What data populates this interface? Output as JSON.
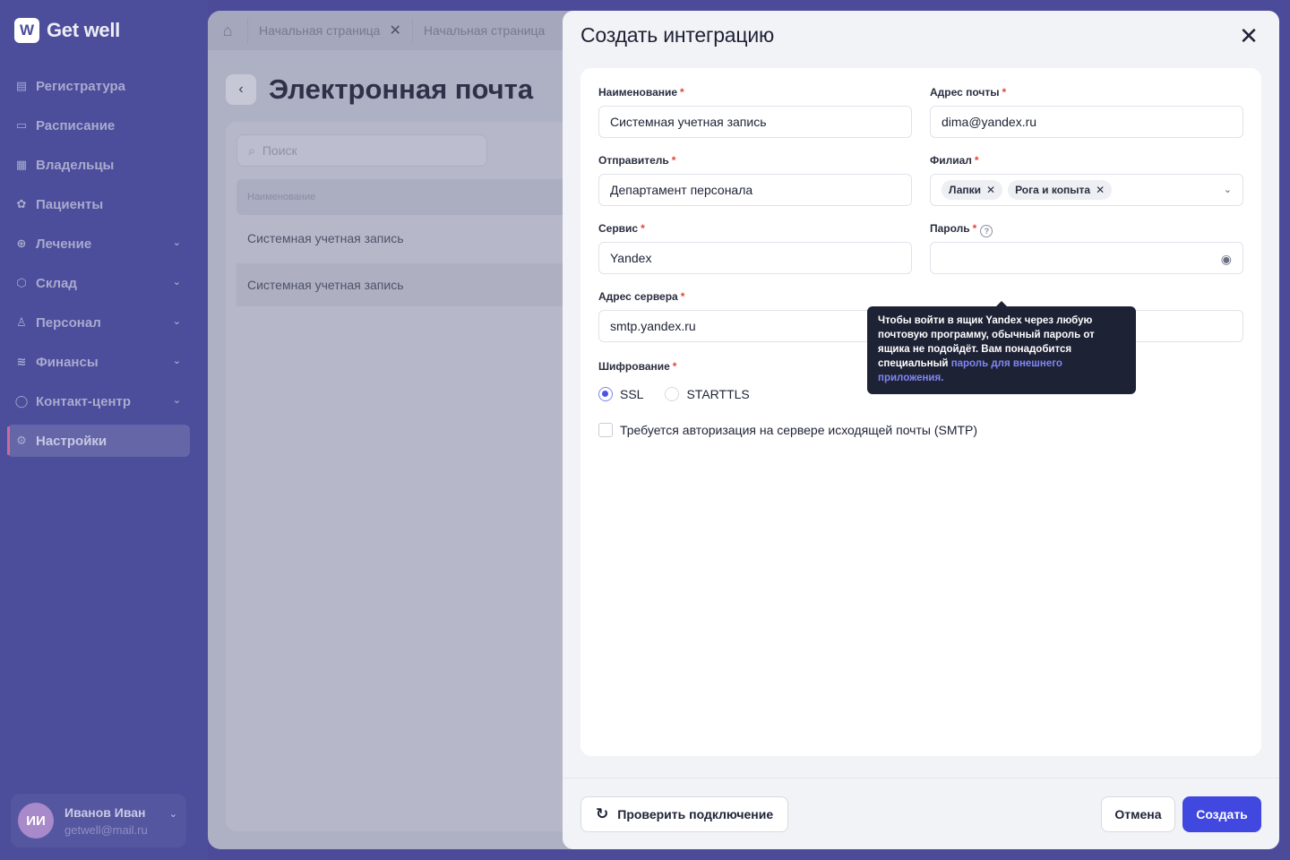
{
  "sidebar": {
    "logo_mark": "W",
    "logo_text": "Get well",
    "items": [
      {
        "label": "Регистратура",
        "icon": "clipboard-icon"
      },
      {
        "label": "Расписание",
        "icon": "calendar-icon"
      },
      {
        "label": "Владельцы",
        "icon": "owners-icon"
      },
      {
        "label": "Пациенты",
        "icon": "paw-icon"
      },
      {
        "label": "Лечение",
        "icon": "medical-plus-icon"
      },
      {
        "label": "Склад",
        "icon": "box-icon"
      },
      {
        "label": "Персонал",
        "icon": "person-icon"
      },
      {
        "label": "Финансы",
        "icon": "coins-icon"
      },
      {
        "label": "Контакт-центр",
        "icon": "chat-icon"
      },
      {
        "label": "Настройки",
        "icon": "gear-icon"
      }
    ],
    "user": {
      "initials": "ИИ",
      "name": "Иванов Иван",
      "email": "getwell@mail.ru"
    }
  },
  "tabs": [
    {
      "label": "Начальная страница"
    },
    {
      "label": "Начальная страница"
    }
  ],
  "page": {
    "title": "Электронная почта",
    "search_placeholder": "Поиск",
    "table_header": "Наименование",
    "rows": [
      "Системная учетная запись",
      "Системная учетная запись"
    ]
  },
  "modal": {
    "title": "Создать интеграцию",
    "fields": {
      "name": {
        "label": "Наименование",
        "value": "Системная учетная запись"
      },
      "email": {
        "label": "Адрес почты",
        "value": "dima@yandex.ru"
      },
      "sender": {
        "label": "Отправитель",
        "value": "Департамент персонала"
      },
      "branch": {
        "label": "Филиал",
        "chips": [
          "Лапки",
          "Рога и копыта"
        ]
      },
      "service": {
        "label": "Сервис",
        "value": "Yandex"
      },
      "password": {
        "label": "Пароль",
        "value": ""
      },
      "server": {
        "label": "Адрес сервера",
        "value": "smtp.yandex.ru"
      }
    },
    "encryption": {
      "label": "Шифрование",
      "options": [
        "SSL",
        "STARTTLS"
      ],
      "selected": "SSL"
    },
    "smtp_auth_label": "Требуется авторизация на сервере исходящей почты (SMTP)",
    "tooltip": {
      "text": "Чтобы войти в ящик Yandex через любую почтовую программу, обычный пароль от ящика не подойдёт. Вам понадобится специальный",
      "link": "пароль для внешнего приложения."
    },
    "footer": {
      "check_label": "Проверить подключение",
      "cancel_label": "Отмена",
      "create_label": "Создать"
    }
  },
  "colors": {
    "sidebar": "#4C4D9B",
    "primary": "#4048E0",
    "required": "#E0463A",
    "tooltip_bg": "#1E2235",
    "link": "#7F87F2"
  }
}
